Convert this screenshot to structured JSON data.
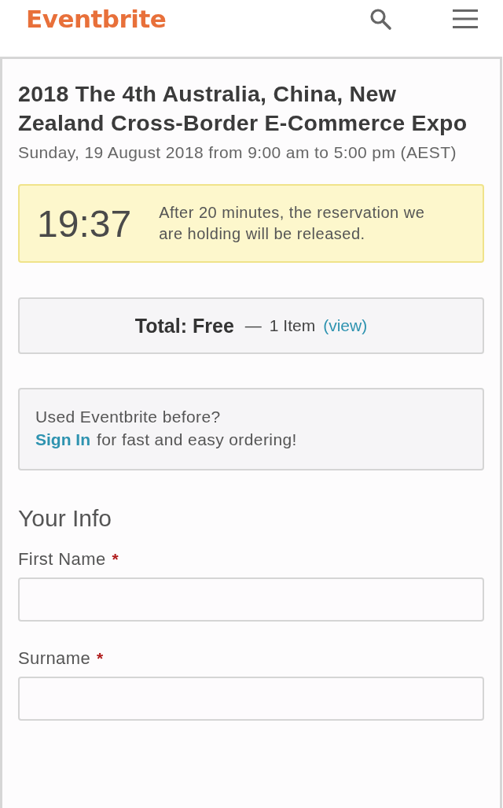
{
  "header": {
    "logo": "Eventbrite"
  },
  "event": {
    "title": "2018 The 4th Australia, China, New Zealand Cross-Border E-Commerce Expo",
    "date": "Sunday, 19 August 2018 from 9:00 am to 5:00 pm (AEST)"
  },
  "timer": {
    "time": "19:37",
    "message": "After 20 minutes, the reservation we are holding will be released."
  },
  "total": {
    "label": "Total: Free",
    "separator": "—",
    "items": "1 Item",
    "link": "(view)"
  },
  "signin": {
    "question": "Used Eventbrite before?",
    "link": "Sign In",
    "rest": "for fast and easy ordering!"
  },
  "form": {
    "heading": "Your Info",
    "fields": [
      {
        "label": "First Name",
        "required_mark": "*"
      },
      {
        "label": "Surname",
        "required_mark": "*"
      }
    ]
  }
}
